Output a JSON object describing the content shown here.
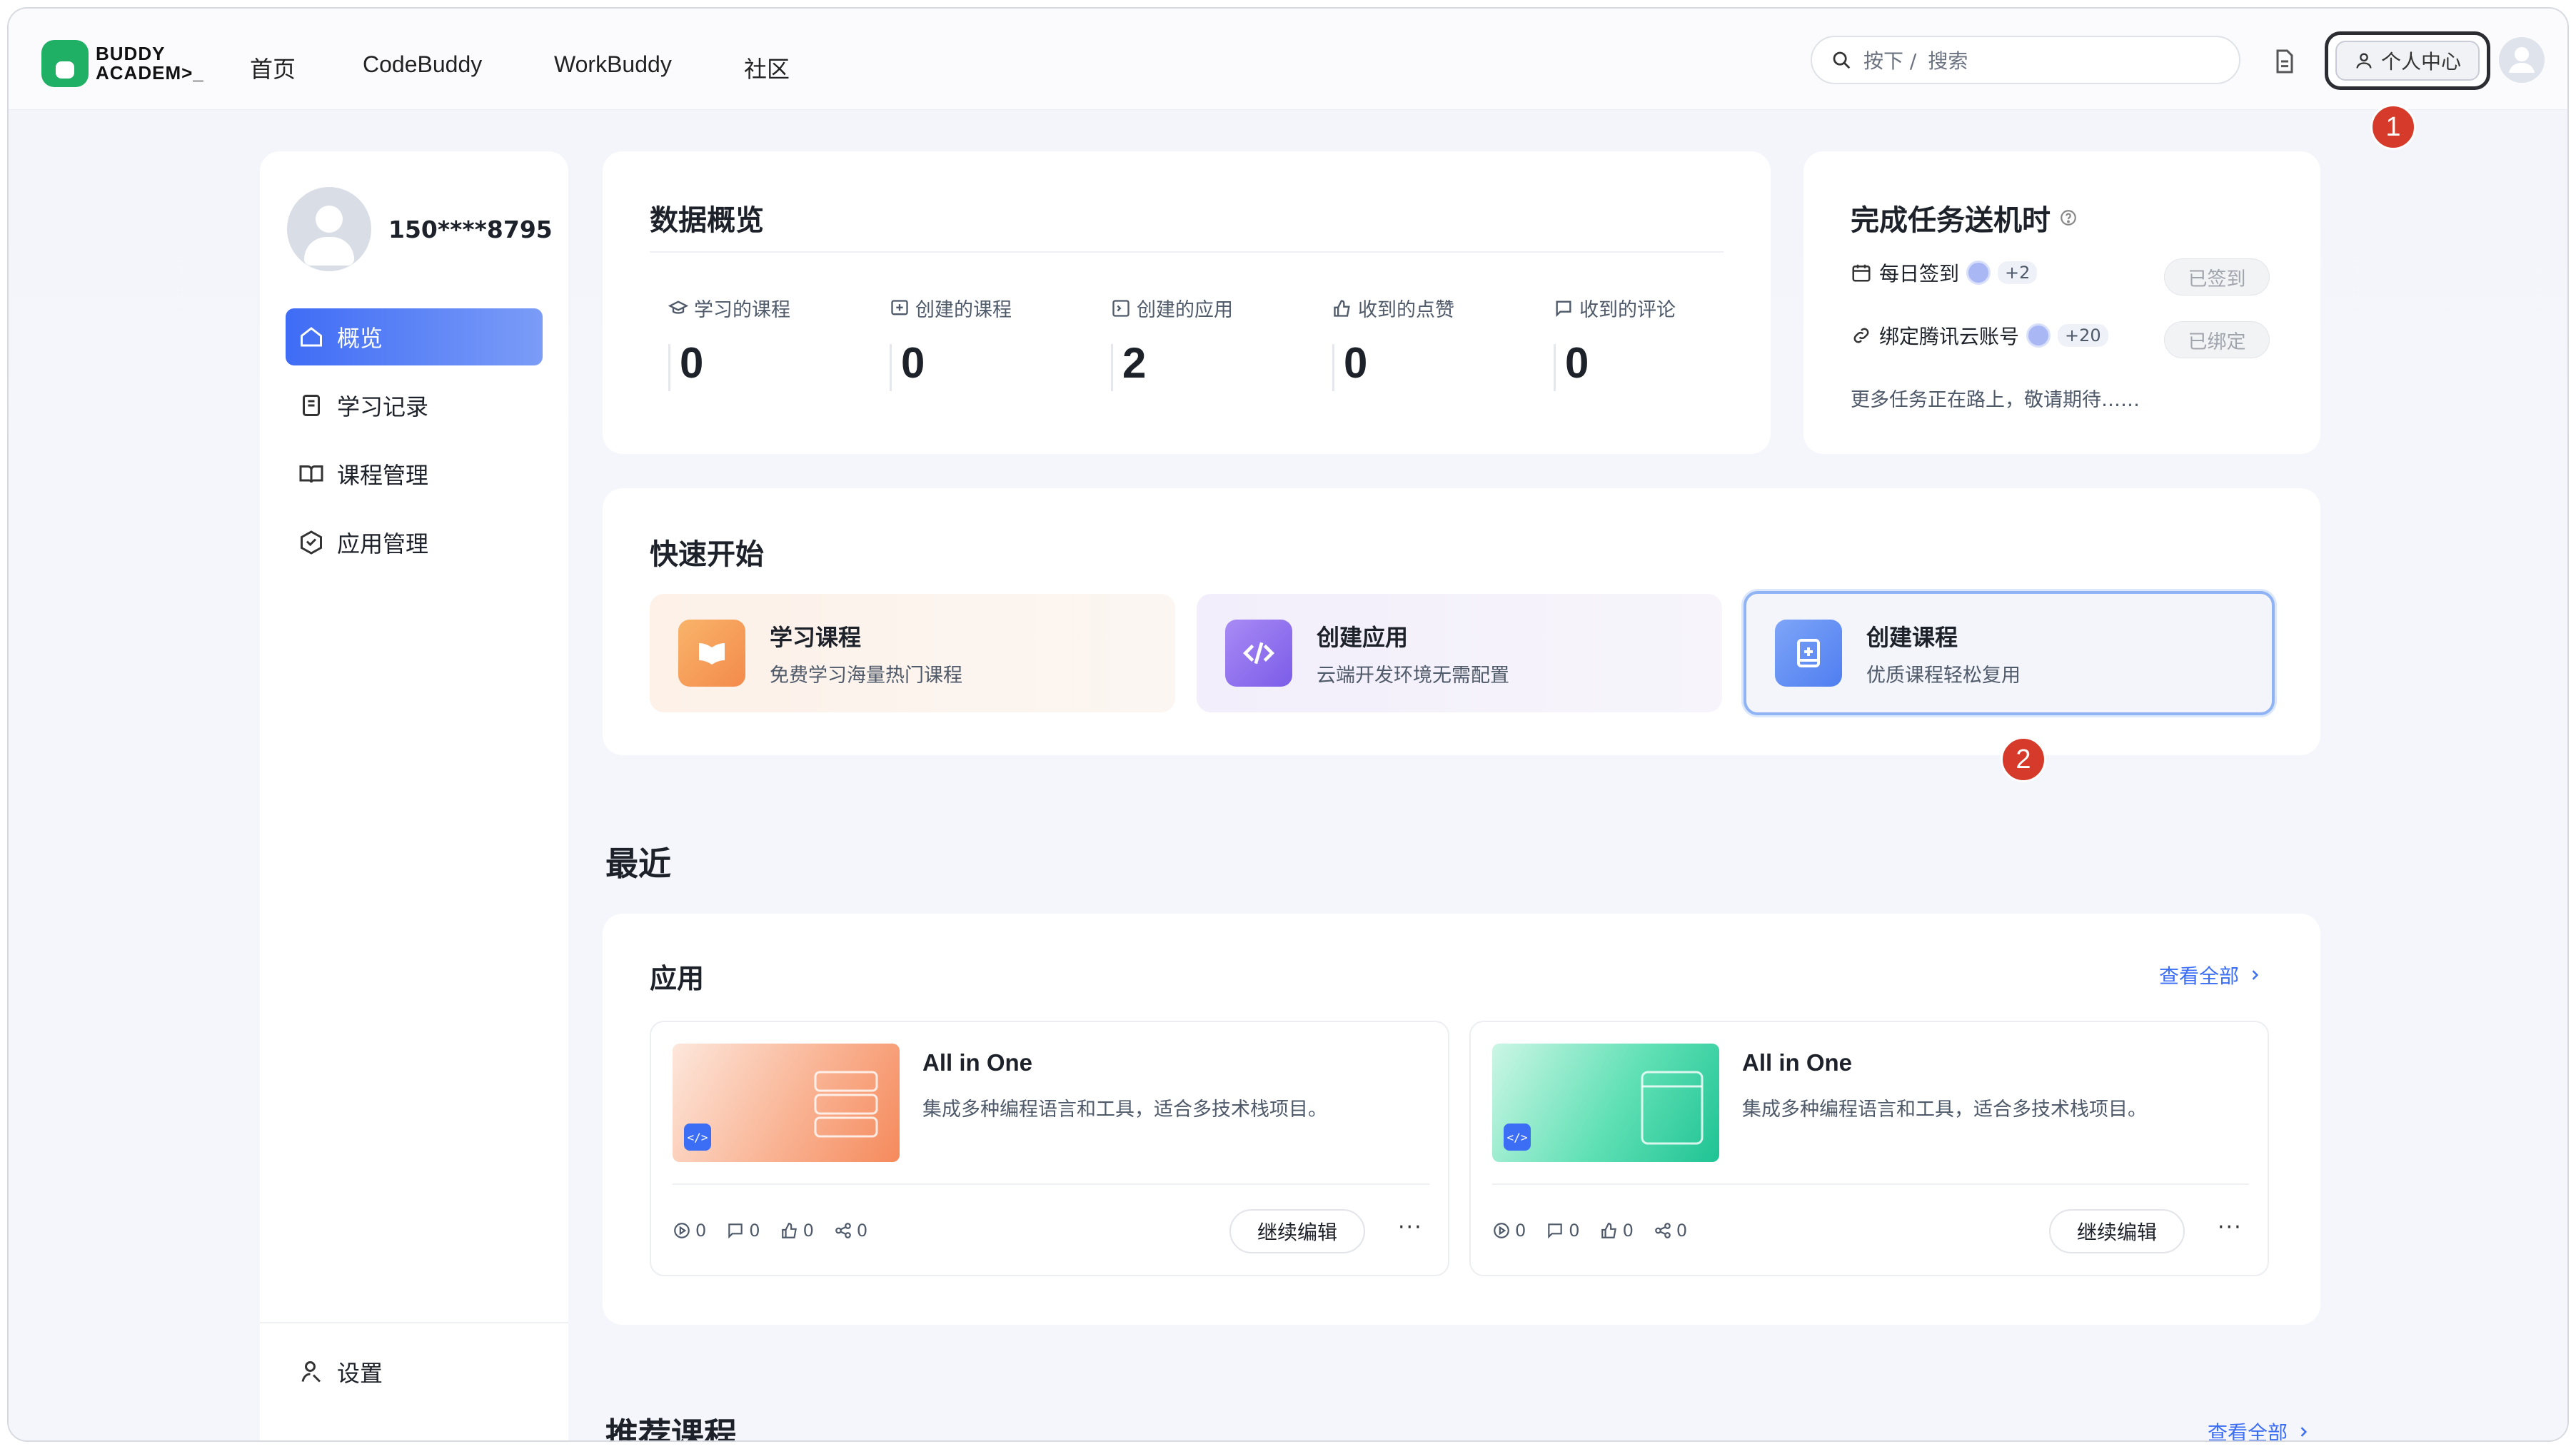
{
  "header": {
    "logo_line1": "BUDDY",
    "logo_line2": "ACADEM>_",
    "nav": [
      "首页",
      "CodeBuddy",
      "WorkBuddy",
      "社区"
    ],
    "search_shortcut": "按下 /",
    "search_placeholder": "搜索",
    "profile_label": "个人中心"
  },
  "annotations": {
    "badge1": "1",
    "badge2": "2"
  },
  "sidebar": {
    "username": "150****8795",
    "items": [
      {
        "label": "概览",
        "icon": "home-icon",
        "active": true
      },
      {
        "label": "学习记录",
        "icon": "record-icon",
        "active": false
      },
      {
        "label": "课程管理",
        "icon": "book-icon",
        "active": false
      },
      {
        "label": "应用管理",
        "icon": "cube-icon",
        "active": false
      }
    ],
    "settings_label": "设置"
  },
  "overview": {
    "title": "数据概览",
    "stats": [
      {
        "label": "学习的课程",
        "value": "0",
        "icon": "graduation-icon"
      },
      {
        "label": "创建的课程",
        "value": "0",
        "icon": "course-create-icon"
      },
      {
        "label": "创建的应用",
        "value": "2",
        "icon": "app-create-icon"
      },
      {
        "label": "收到的点赞",
        "value": "0",
        "icon": "thumbs-up-icon"
      },
      {
        "label": "收到的评论",
        "value": "0",
        "icon": "comment-icon"
      }
    ]
  },
  "tasks": {
    "title": "完成任务送机时",
    "items": [
      {
        "label": "每日签到",
        "reward": "+2",
        "button": "已签到",
        "icon": "calendar-icon"
      },
      {
        "label": "绑定腾讯云账号",
        "reward": "+20",
        "button": "已绑定",
        "icon": "link-icon"
      }
    ],
    "footer": "更多任务正在路上，敬请期待……"
  },
  "quickstart": {
    "title": "快速开始",
    "items": [
      {
        "title": "学习课程",
        "subtitle": "免费学习海量热门课程"
      },
      {
        "title": "创建应用",
        "subtitle": "云端开发环境无需配置"
      },
      {
        "title": "创建课程",
        "subtitle": "优质课程轻松复用"
      }
    ]
  },
  "recent": {
    "title": "最近",
    "apps_title": "应用",
    "view_all": "查看全部",
    "apps": [
      {
        "name": "All in One",
        "desc": "集成多种编程语言和工具，适合多技术栈项目。",
        "plays": "0",
        "comments": "0",
        "likes": "0",
        "shares": "0",
        "button": "继续编辑",
        "thumb_color": "#f6a07a"
      },
      {
        "name": "All in One",
        "desc": "集成多种编程语言和工具，适合多技术栈项目。",
        "plays": "0",
        "comments": "0",
        "likes": "0",
        "shares": "0",
        "button": "继续编辑",
        "thumb_color": "#3fd6a6"
      }
    ]
  },
  "recommended": {
    "title": "推荐课程",
    "view_all": "查看全部"
  }
}
